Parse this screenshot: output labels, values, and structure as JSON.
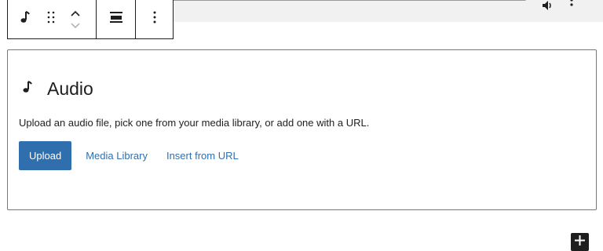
{
  "toolbar": {
    "block_icon": "music-note-icon",
    "drag_icon": "drag-handle-icon",
    "move_up_icon": "chevron-up-icon",
    "move_down_icon": "chevron-down-icon",
    "align_icon": "align-center-icon",
    "more_icon": "more-vertical-icon"
  },
  "player": {
    "volume_icon": "volume-icon",
    "more_icon": "more-vertical-icon"
  },
  "placeholder": {
    "icon": "music-note-icon",
    "title": "Audio",
    "instructions": "Upload an audio file, pick one from your media library, or add one with a URL.",
    "upload_label": "Upload",
    "media_library_label": "Media Library",
    "insert_url_label": "Insert from URL"
  },
  "inserter": {
    "icon": "plus-icon"
  },
  "colors": {
    "accent": "#2f6fad",
    "block_border": "#3a87c4",
    "text": "#1e1e1e"
  }
}
